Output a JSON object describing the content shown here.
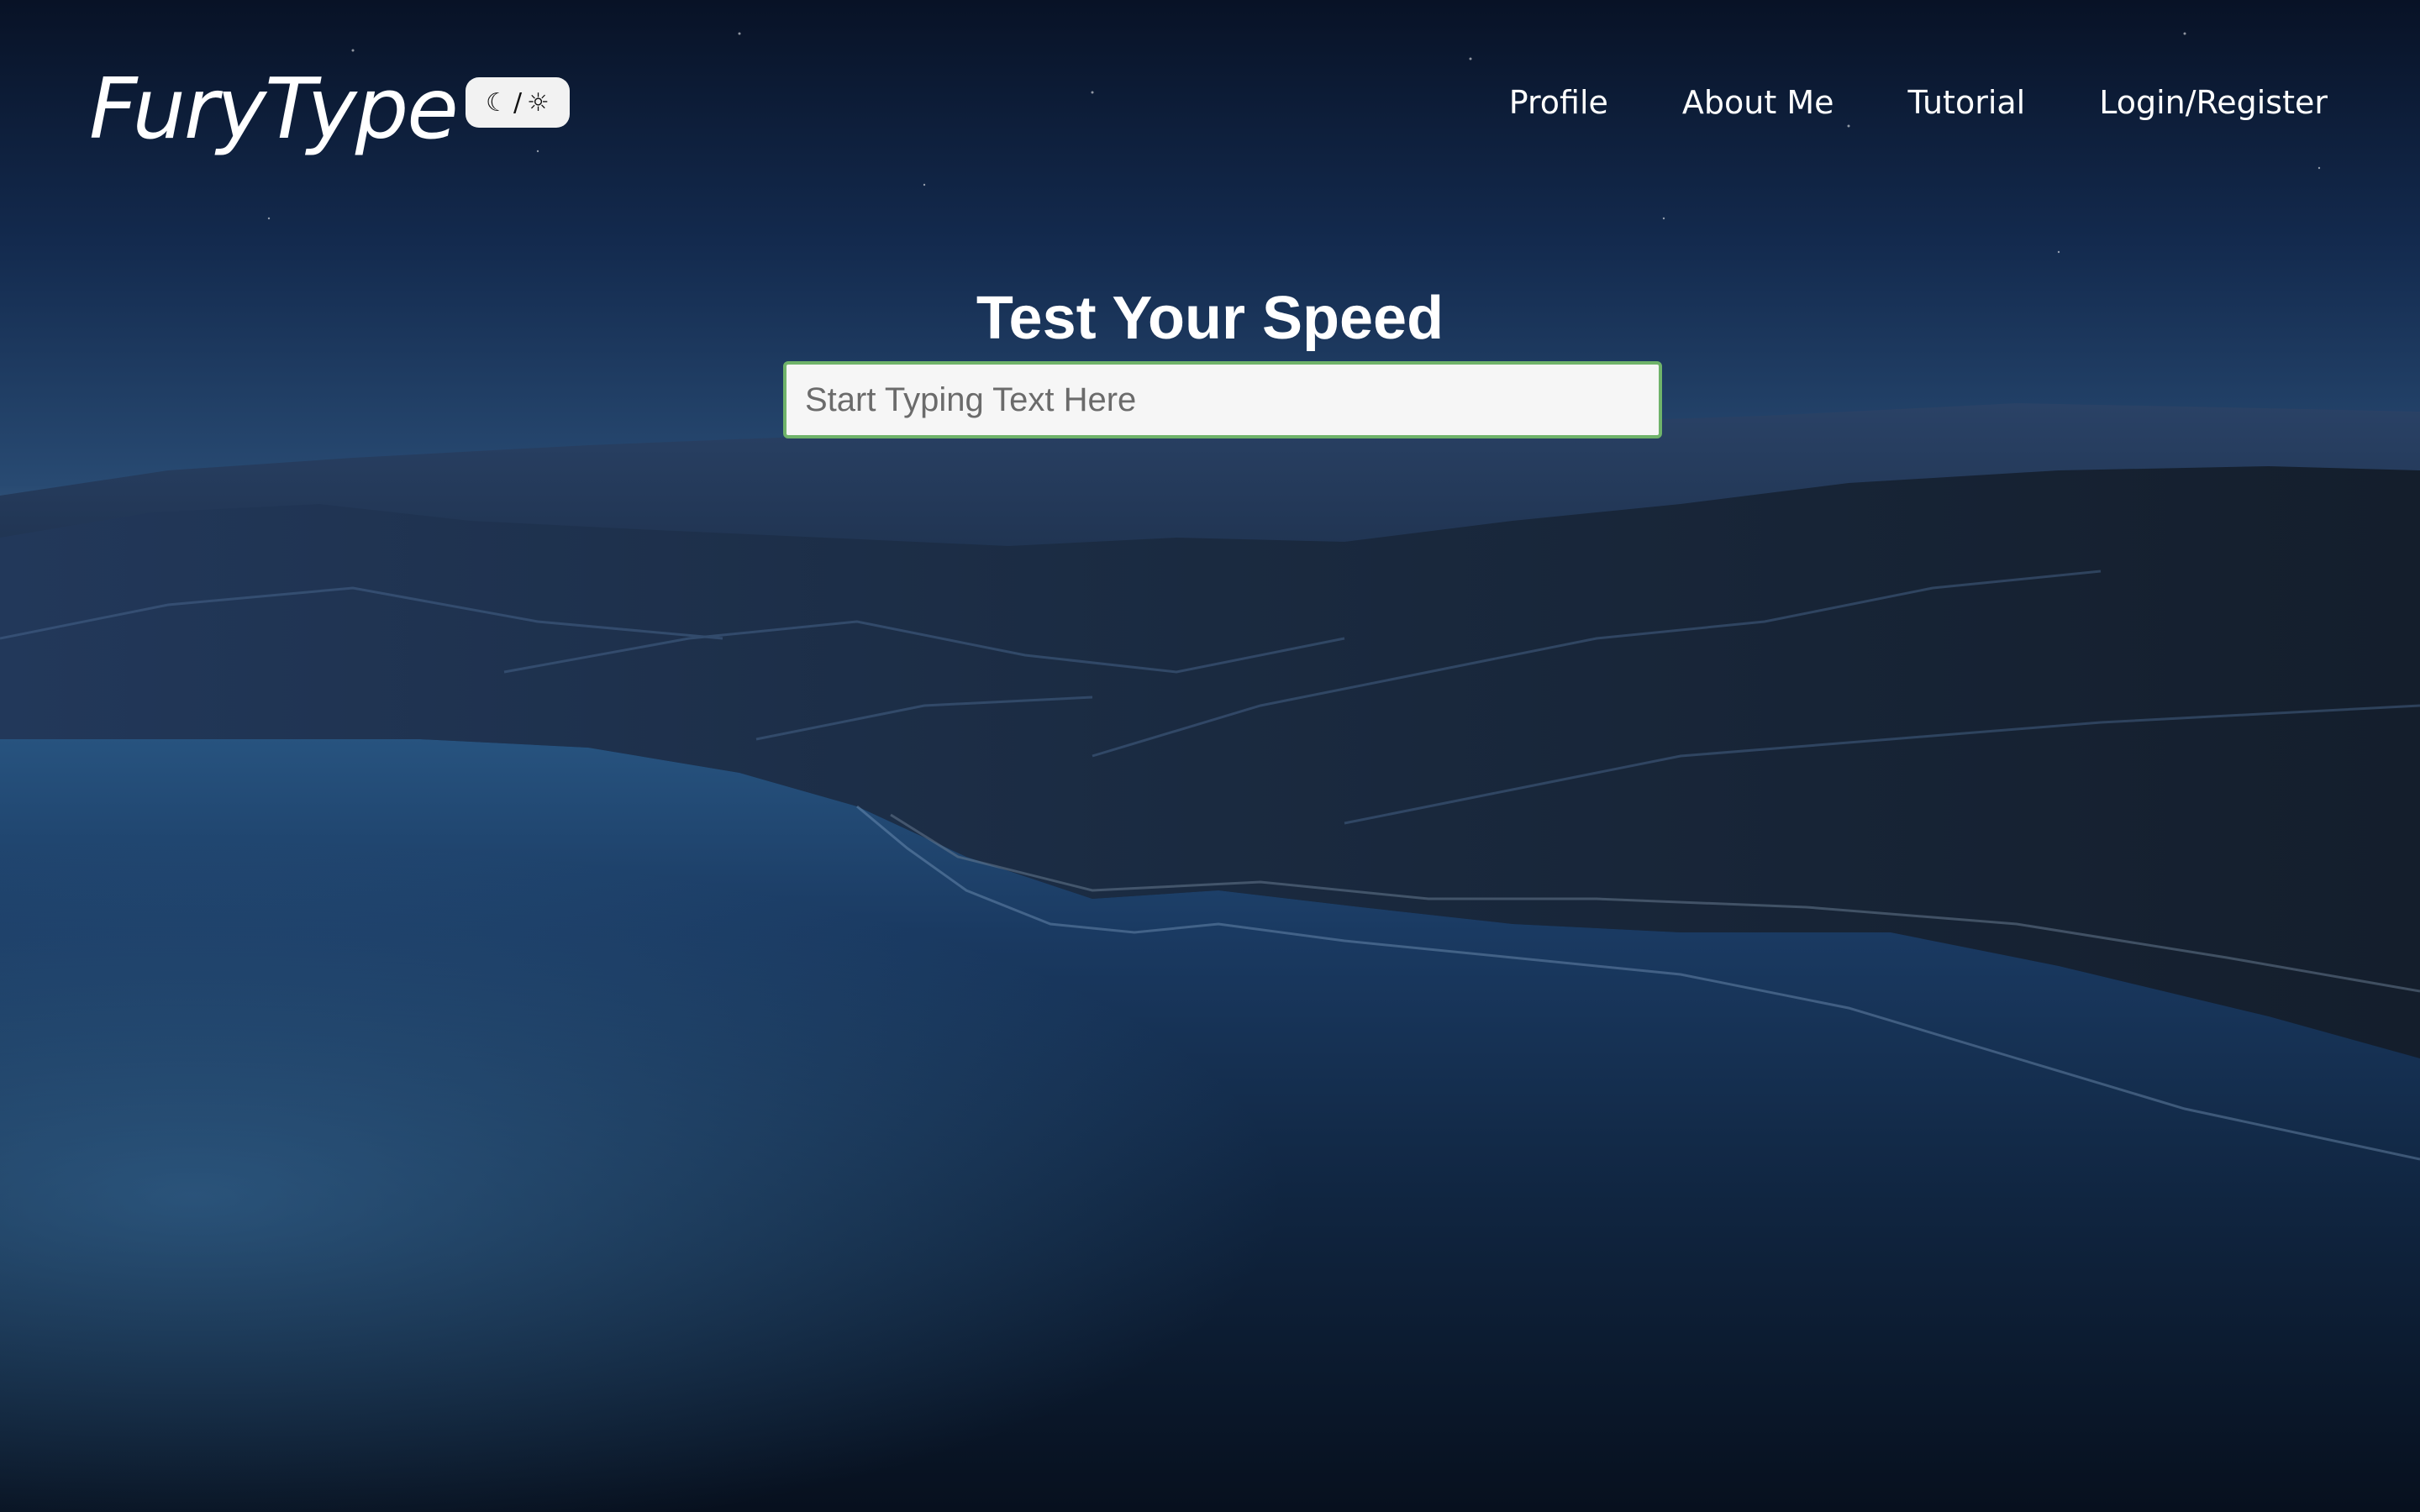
{
  "header": {
    "logo": "FuryType",
    "theme_toggle": {
      "moon_glyph": "☾",
      "separator": "/",
      "sun_glyph": "☼"
    },
    "nav": [
      {
        "label": "Profile"
      },
      {
        "label": "About Me"
      },
      {
        "label": "Tutorial"
      },
      {
        "label": "Login/Register"
      }
    ]
  },
  "main": {
    "title": "Test Your Speed",
    "input": {
      "value": "",
      "placeholder": "Start Typing Text Here"
    }
  },
  "colors": {
    "input_border": "#6fb36a",
    "text": "#ffffff",
    "toggle_bg": "#f2f2f2"
  },
  "icons": {
    "theme_toggle": [
      "moon-icon",
      "sun-icon"
    ]
  }
}
